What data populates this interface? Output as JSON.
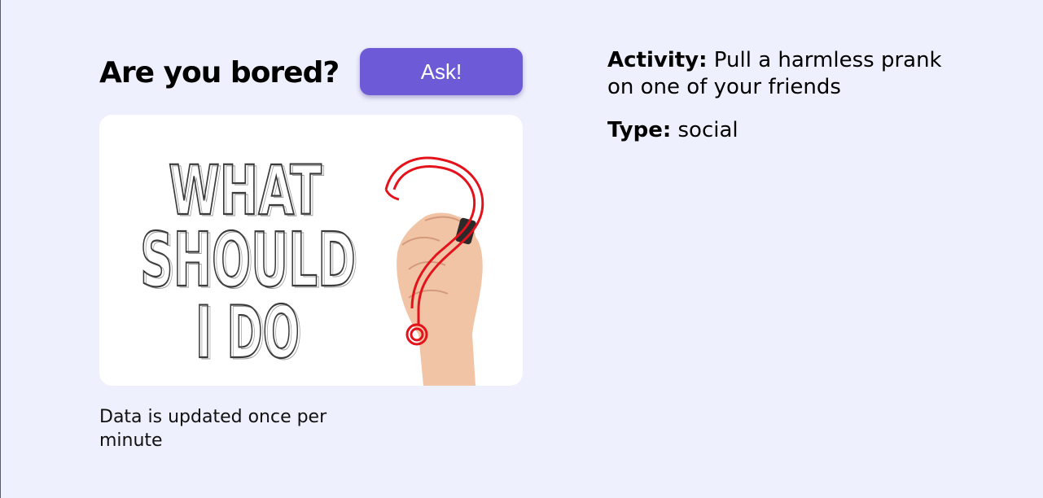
{
  "header": {
    "title": "Are you bored?",
    "ask_button_label": "Ask!"
  },
  "image": {
    "alt_words": [
      "WHAT",
      "SHOULD",
      "I DO"
    ]
  },
  "note": "Data is updated once per minute",
  "activity": {
    "label": "Activity:",
    "value": "Pull a harmless prank on one of your friends"
  },
  "type": {
    "label": "Type:",
    "value": "social"
  },
  "colors": {
    "background": "#eef0fd",
    "button": "#6c5ad6",
    "question_mark": "#e4131b"
  }
}
